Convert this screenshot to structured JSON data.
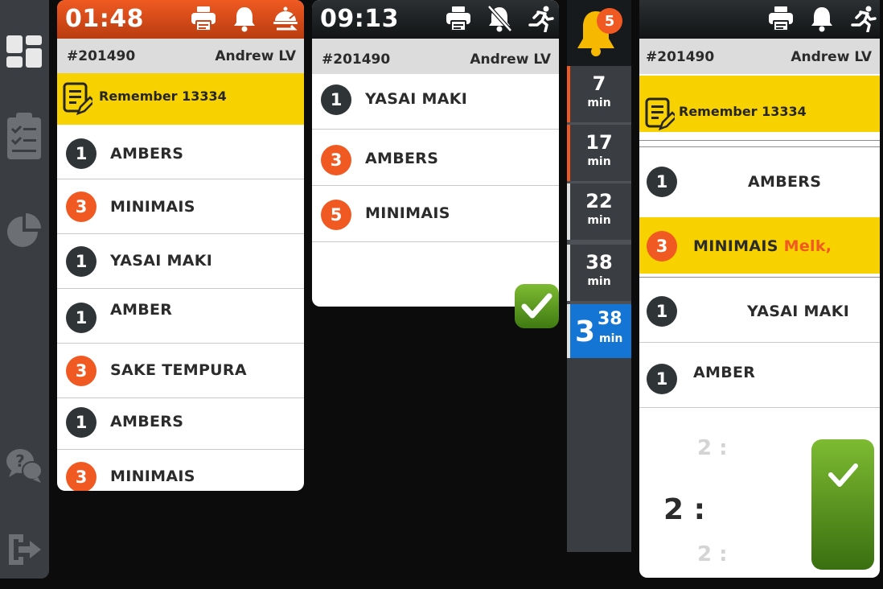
{
  "colors": {
    "accent_orange": "#f05a22",
    "note_yellow": "#f8d100",
    "check_green": "#5a9a1e",
    "active_timer_blue": "#1575d4",
    "dark_badge": "#2f3437"
  },
  "sidebar": {
    "items": [
      {
        "icon": "dashboard-icon"
      },
      {
        "icon": "checklist-icon"
      },
      {
        "icon": "pie-chart-icon"
      },
      {
        "icon": "help-chat-icon"
      },
      {
        "icon": "logout-icon"
      }
    ]
  },
  "order1": {
    "time": "01:48",
    "number": "#201490",
    "waiter": "Andrew LV",
    "note": "Remember 13334",
    "items": [
      {
        "qty": "1",
        "name": "AMBERS"
      },
      {
        "qty": "3",
        "name": "MINIMAIS"
      },
      {
        "qty": "1",
        "name": "YASAI MAKI"
      },
      {
        "qty": "1",
        "name": "AMBER"
      },
      {
        "qty": "3",
        "name": "SAKE TEMPURA"
      },
      {
        "qty": "1",
        "name": "AMBERS"
      },
      {
        "qty": "3",
        "name": "MINIMAIS"
      }
    ]
  },
  "order2": {
    "time": "09:13",
    "number": "#201490",
    "waiter": "Andrew LV",
    "items": [
      {
        "qty": "1",
        "name": "YASAI MAKI"
      },
      {
        "qty": "3",
        "name": "AMBERS"
      },
      {
        "qty": "5",
        "name": "MINIMAIS"
      }
    ]
  },
  "timers": {
    "bell_count": "5",
    "list": [
      {
        "value": "7",
        "unit": "min"
      },
      {
        "value": "17",
        "unit": "min"
      },
      {
        "value": "22",
        "unit": "min"
      },
      {
        "value": "38",
        "unit": "min"
      }
    ],
    "active": {
      "big": "3",
      "value": "38",
      "unit": "min"
    }
  },
  "order3": {
    "number": "#201490",
    "waiter": "Andrew LV",
    "note": "Remember 13334",
    "items": [
      {
        "qty": "1",
        "name": "AMBERS",
        "modifier": ""
      },
      {
        "qty": "3",
        "name": "MINIMAIS",
        "modifier": "Melk,"
      },
      {
        "qty": "1",
        "name": "YASAI MAKI",
        "modifier": ""
      },
      {
        "qty": "1",
        "name": "AMBER",
        "modifier": ""
      }
    ],
    "picker": {
      "prev": "2 :",
      "current": "2 :",
      "next": "2 :"
    }
  }
}
